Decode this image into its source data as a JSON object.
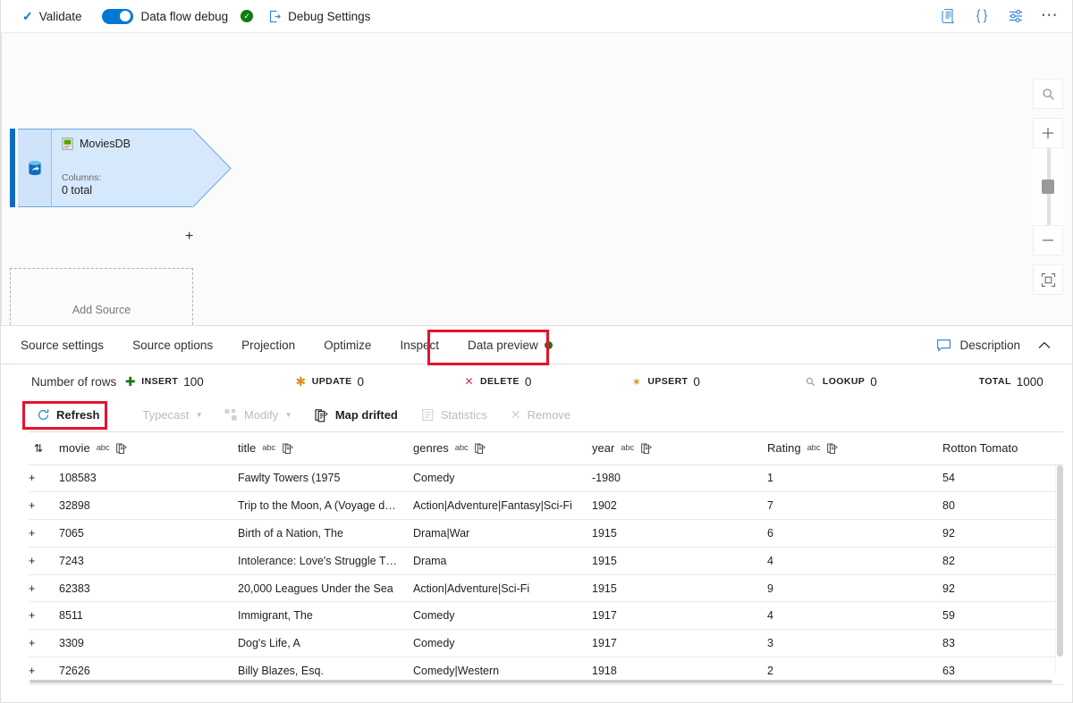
{
  "toolbar": {
    "validate_label": "Validate",
    "data_flow_debug_label": "Data flow debug",
    "debug_settings_label": "Debug Settings",
    "debug_toggle_on": true,
    "icons": {
      "check": "check-icon",
      "debug_status": "green-check-icon",
      "debug_settings": "debug-settings-icon",
      "script": "script-icon",
      "code": "code-braces-icon",
      "settings": "settings-sliders-icon",
      "more": "ellipsis-icon"
    }
  },
  "canvas": {
    "source_node": {
      "title": "MoviesDB",
      "columns_label": "Columns:",
      "columns_value": "0 total",
      "accent_color": "#0f6cbd",
      "body_color": "#d6e8fb"
    },
    "add_source_label": "Add Source",
    "plus_label": "+",
    "zoom_controls": {
      "search": "search-icon",
      "zoom_in": "+",
      "zoom_out": "−",
      "fit": "fit-to-screen-icon"
    }
  },
  "tabs": [
    {
      "label": "Source settings",
      "active": false,
      "dot": false
    },
    {
      "label": "Source options",
      "active": false,
      "dot": false
    },
    {
      "label": "Projection",
      "active": false,
      "dot": false
    },
    {
      "label": "Optimize",
      "active": false,
      "dot": false
    },
    {
      "label": "Inspect",
      "active": false,
      "dot": false
    },
    {
      "label": "Data preview",
      "active": true,
      "dot": true
    }
  ],
  "tabbar_right": {
    "description_label": "Description",
    "collapse_icon": "chevron-up-icon"
  },
  "stats": {
    "rows_label": "Number of rows",
    "items": [
      {
        "key": "INSERT",
        "value": "100",
        "icon": "plus-icon",
        "color": "#107c10"
      },
      {
        "key": "UPDATE",
        "value": "0",
        "icon": "asterisk-icon",
        "color": "#d99121"
      },
      {
        "key": "DELETE",
        "value": "0",
        "icon": "cross-icon",
        "color": "#c4314b"
      },
      {
        "key": "UPSERT",
        "value": "0",
        "icon": "upsert-icon",
        "color": "#d99121"
      },
      {
        "key": "LOOKUP",
        "value": "0",
        "icon": "search-icon",
        "color": "#97958f"
      },
      {
        "key": "TOTAL",
        "value": "1000",
        "icon": "",
        "color": ""
      }
    ]
  },
  "actions": [
    {
      "label": "Refresh",
      "icon": "refresh-icon",
      "enabled": true,
      "caret": false,
      "highlighted": true
    },
    {
      "label": "Typecast",
      "icon": "typecast-icon",
      "enabled": false,
      "caret": true,
      "highlighted": false
    },
    {
      "label": "Modify",
      "icon": "modify-icon",
      "enabled": false,
      "caret": true,
      "highlighted": false
    },
    {
      "label": "Map drifted",
      "icon": "map-drifted-icon",
      "enabled": true,
      "caret": false,
      "highlighted": false
    },
    {
      "label": "Statistics",
      "icon": "statistics-icon",
      "enabled": false,
      "caret": false,
      "highlighted": false
    },
    {
      "label": "Remove",
      "icon": "remove-icon",
      "enabled": false,
      "caret": false,
      "highlighted": false
    }
  ],
  "table": {
    "sort_icon": "sort-icon",
    "columns": [
      {
        "name": "movie",
        "type": "abc",
        "drift_icon": true
      },
      {
        "name": "title",
        "type": "abc",
        "drift_icon": true
      },
      {
        "name": "genres",
        "type": "abc",
        "drift_icon": true
      },
      {
        "name": "year",
        "type": "abc",
        "drift_icon": true
      },
      {
        "name": "Rating",
        "type": "abc",
        "drift_icon": true
      },
      {
        "name": "Rotton Tomato",
        "type": "",
        "drift_icon": false
      }
    ],
    "row_marker": "+",
    "rows": [
      {
        "movie": "108583",
        "title": "Fawlty Towers (1975",
        "genres": "Comedy",
        "year": "-1980",
        "rating": "1",
        "tomato": "54"
      },
      {
        "movie": "32898",
        "title": "Trip to the Moon, A (Voyage d…",
        "genres": "Action|Adventure|Fantasy|Sci-Fi",
        "year": "1902",
        "rating": "7",
        "tomato": "80"
      },
      {
        "movie": "7065",
        "title": "Birth of a Nation, The",
        "genres": "Drama|War",
        "year": "1915",
        "rating": "6",
        "tomato": "92"
      },
      {
        "movie": "7243",
        "title": "Intolerance: Love's Struggle T…",
        "genres": "Drama",
        "year": "1915",
        "rating": "4",
        "tomato": "82"
      },
      {
        "movie": "62383",
        "title": "20,000 Leagues Under the Sea",
        "genres": "Action|Adventure|Sci-Fi",
        "year": "1915",
        "rating": "9",
        "tomato": "92"
      },
      {
        "movie": "8511",
        "title": "Immigrant, The",
        "genres": "Comedy",
        "year": "1917",
        "rating": "4",
        "tomato": "59"
      },
      {
        "movie": "3309",
        "title": "Dog's Life, A",
        "genres": "Comedy",
        "year": "1917",
        "rating": "3",
        "tomato": "83"
      },
      {
        "movie": "72626",
        "title": "Billy Blazes, Esq.",
        "genres": "Comedy|Western",
        "year": "1918",
        "rating": "2",
        "tomato": "63"
      }
    ]
  },
  "annotations": [
    {
      "target": "data-preview-tab",
      "color": "#e8112d"
    },
    {
      "target": "refresh-button",
      "color": "#e8112d"
    }
  ]
}
